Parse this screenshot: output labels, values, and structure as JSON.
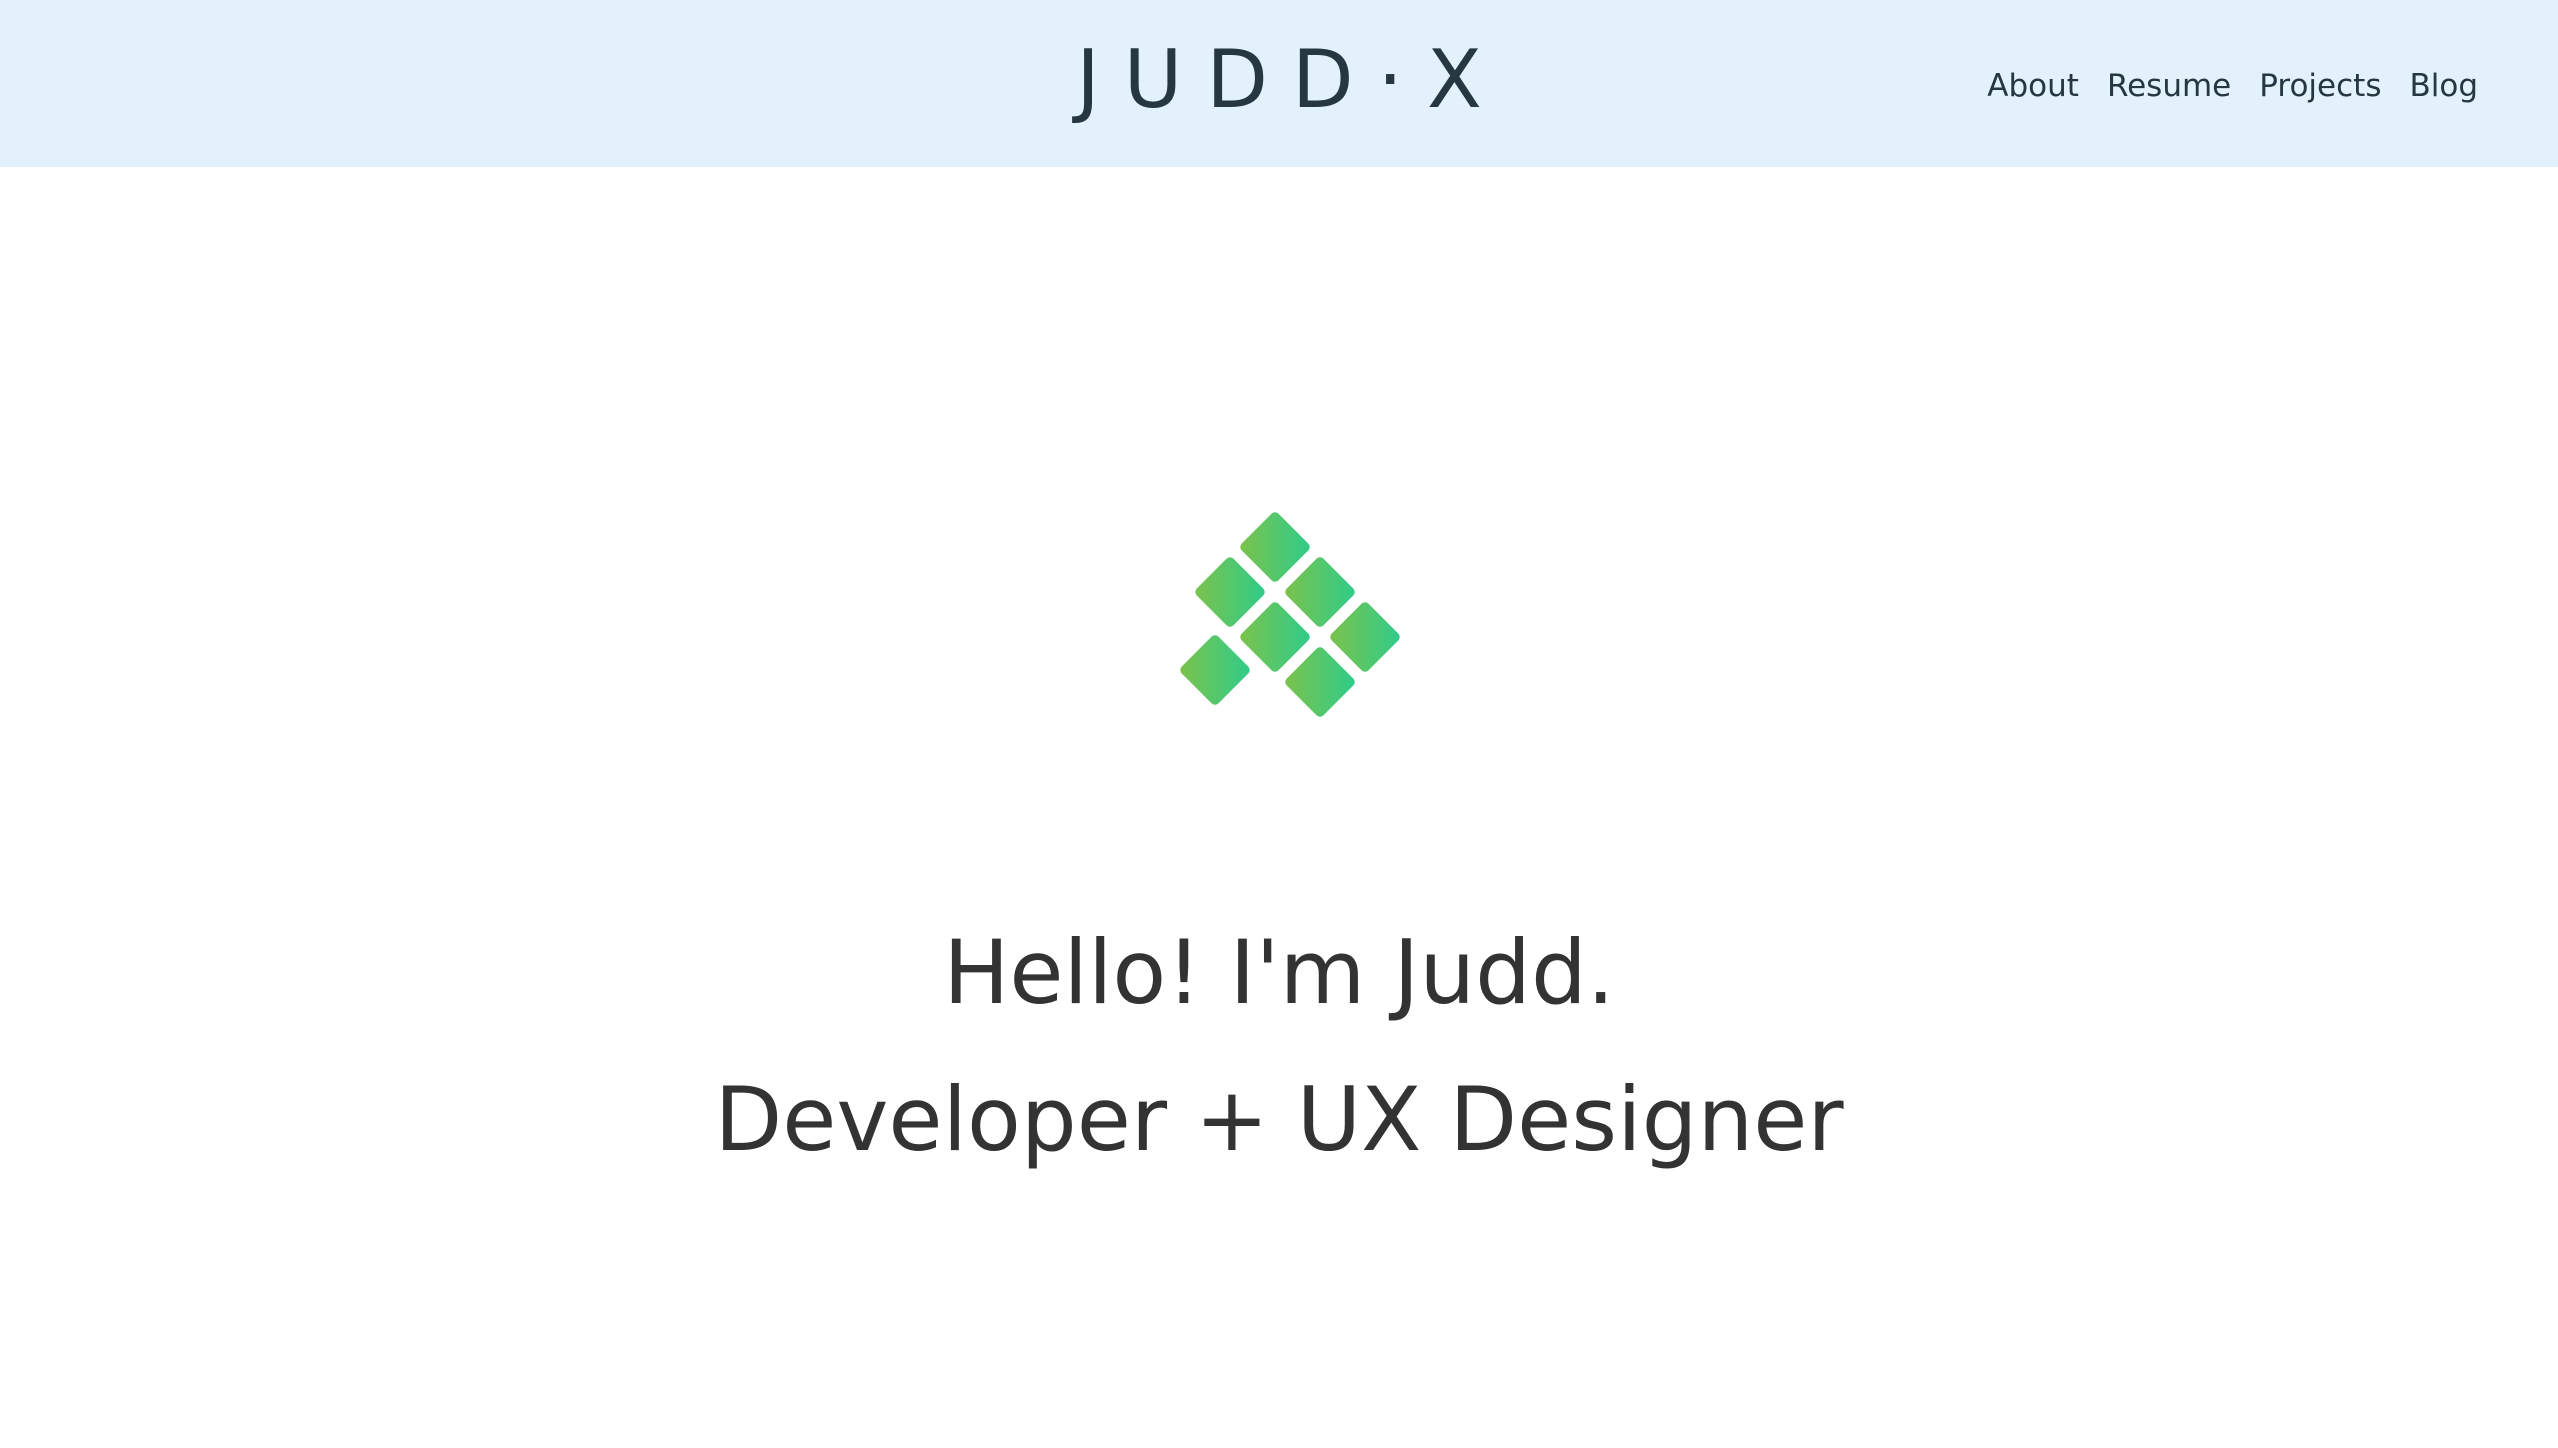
{
  "header": {
    "brand": "JUDD·X",
    "nav": [
      {
        "label": "About"
      },
      {
        "label": "Resume"
      },
      {
        "label": "Projects"
      },
      {
        "label": "Blog"
      }
    ]
  },
  "hero": {
    "logo_icon": "green-diamond-tiles-icon",
    "greeting": "Hello! I'm Judd.",
    "role": "Developer + UX Designer"
  },
  "colors": {
    "header_bg": "#e3f1fc",
    "brand_text": "#263740",
    "body_text": "#333333",
    "logo_gradient_start": "#7dc24b",
    "logo_gradient_end": "#2ecc8b"
  }
}
